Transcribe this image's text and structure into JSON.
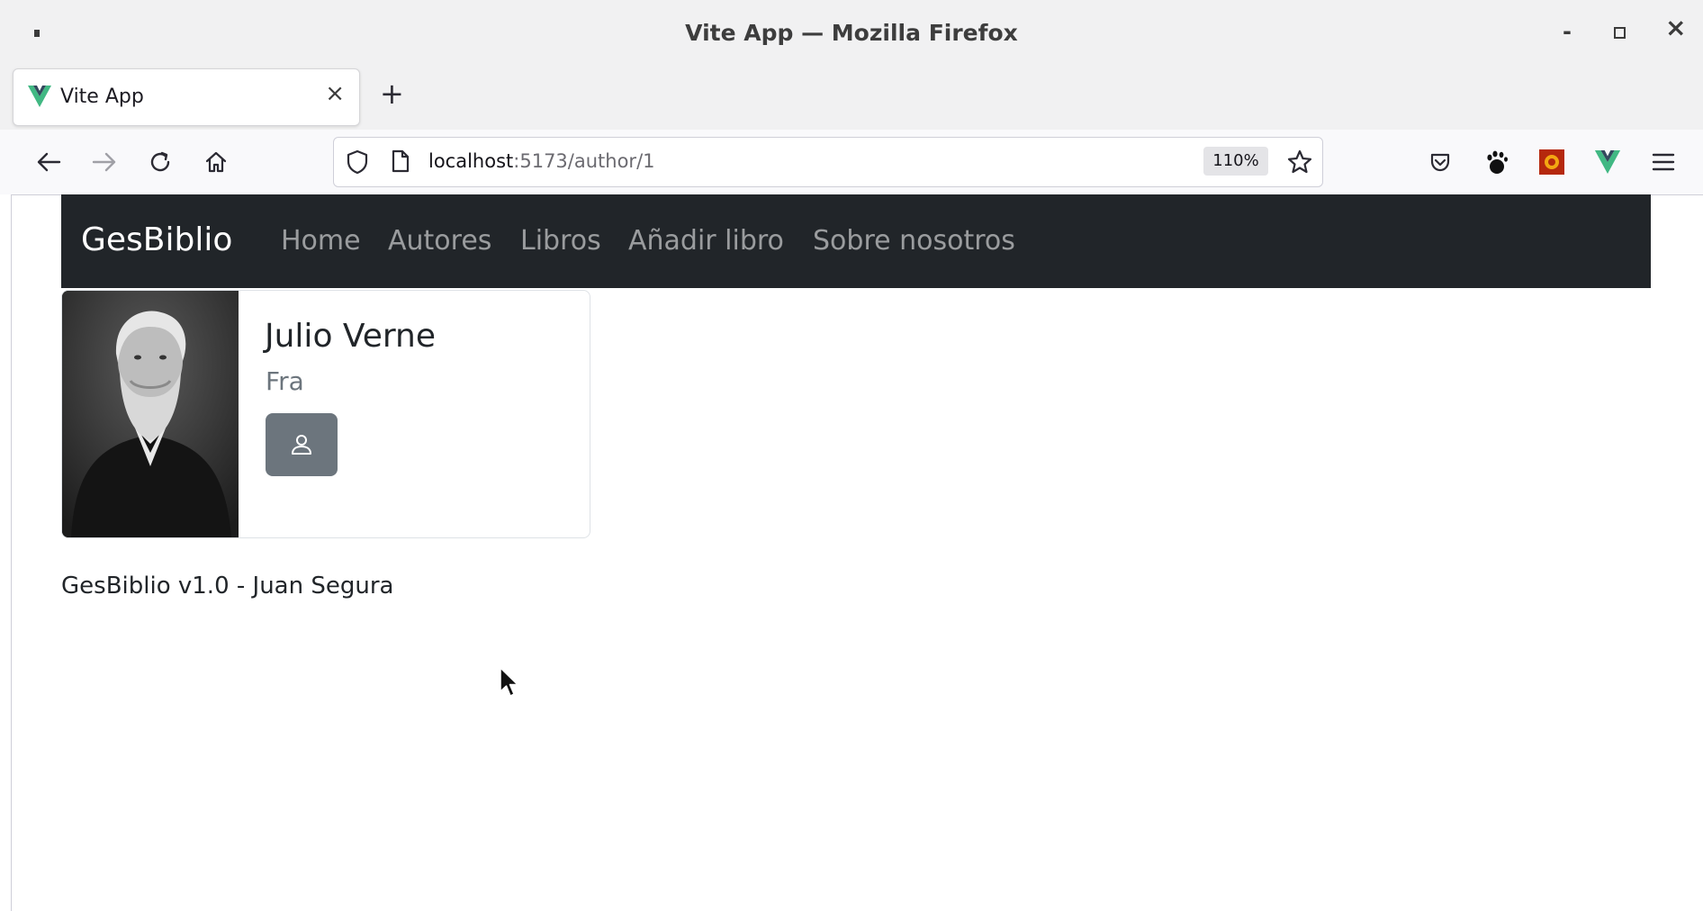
{
  "window": {
    "title": "Vite App — Mozilla Firefox",
    "controls": [
      "-",
      "▫",
      "×"
    ]
  },
  "browser": {
    "tab_title": "Vite App",
    "tab_close": "×",
    "new_tab": "+",
    "url_host": "localhost",
    "url_path": ":5173/author/1",
    "zoom": "110%"
  },
  "site": {
    "brand": "GesBiblio",
    "nav_links": [
      "Home",
      "Autores",
      "Libros",
      "Añadir libro",
      "Sobre nosotros"
    ]
  },
  "author": {
    "name": "Julio Verne",
    "country": "Fra"
  },
  "footer": {
    "text": "GesBiblio v1.0 - Juan Segura"
  },
  "colors": {
    "navbar_bg": "#212529",
    "button_secondary": "#6c757d",
    "vue_green": "#41b883"
  }
}
